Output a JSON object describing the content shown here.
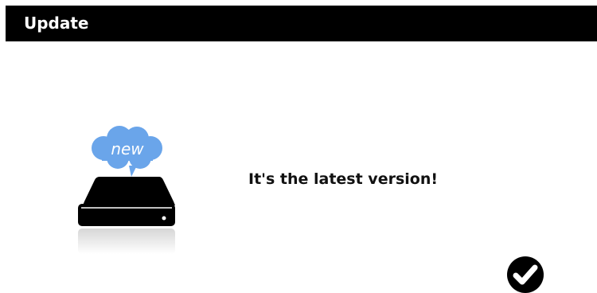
{
  "window": {
    "title": "Update"
  },
  "content": {
    "badge_text": "new",
    "message": "It's the latest version!",
    "device_icon": "hard-drive-icon",
    "badge_icon": "cloud-bubble-icon"
  },
  "actions": {
    "confirm_icon": "checkmark-circle-icon"
  },
  "colors": {
    "title_bar": "#000000",
    "title_text": "#ffffff",
    "badge": "#6aa5ea",
    "device": "#000000",
    "background": "#ffffff"
  }
}
